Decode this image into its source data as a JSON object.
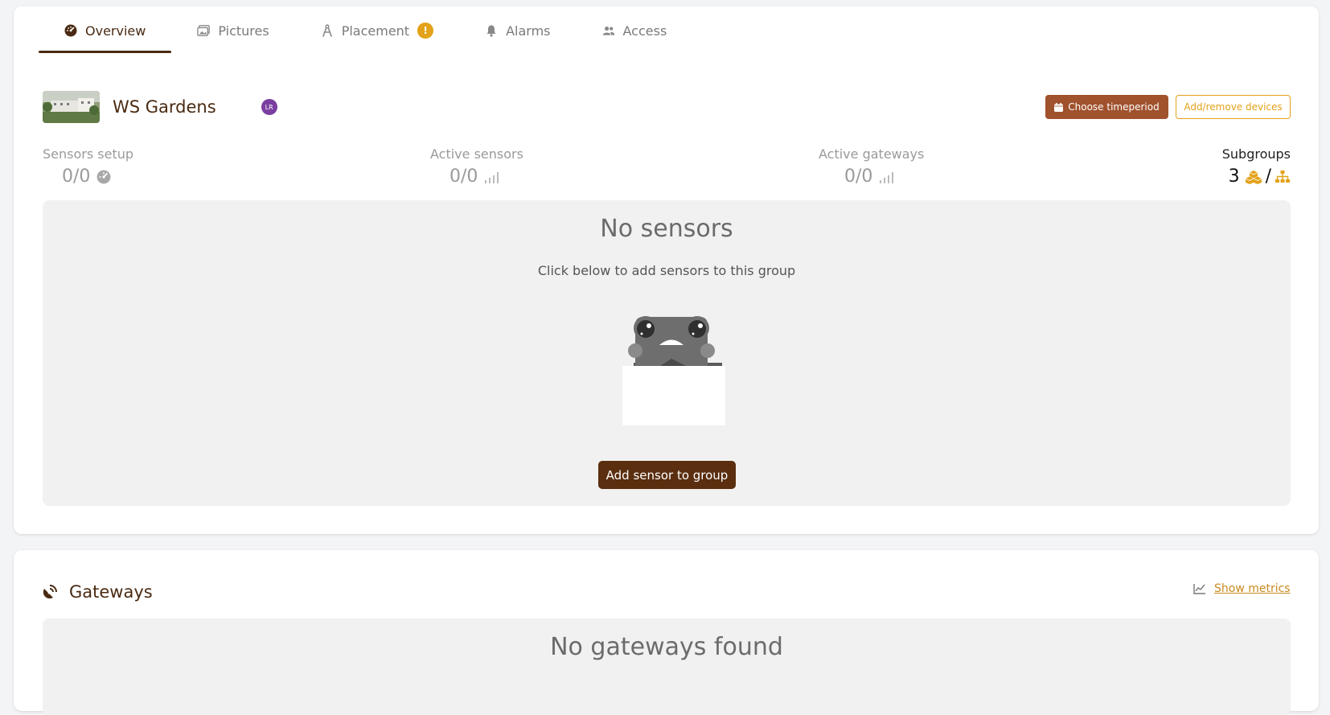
{
  "tabs": [
    {
      "label": "Overview",
      "icon": "dashboard-icon",
      "active": true
    },
    {
      "label": "Pictures",
      "icon": "images-icon"
    },
    {
      "label": "Placement",
      "icon": "compass-icon",
      "badge": "!"
    },
    {
      "label": "Alarms",
      "icon": "bell-icon"
    },
    {
      "label": "Access",
      "icon": "users-icon"
    }
  ],
  "group": {
    "name": "WS Gardens",
    "owner_initials": "LR"
  },
  "actions": {
    "choose_timeperiod": "Choose timeperiod",
    "add_remove_devices": "Add/remove devices"
  },
  "stats": {
    "sensors_setup": {
      "label": "Sensors setup",
      "value": "0/0"
    },
    "active_sensors": {
      "label": "Active sensors",
      "value": "0/0"
    },
    "active_gateways": {
      "label": "Active gateways",
      "value": "0/0"
    },
    "subgroups": {
      "label": "Subgroups",
      "value": "3",
      "separator": "/"
    }
  },
  "empty_sensors": {
    "title": "No sensors",
    "subtitle": "Click below to add sensors to this group",
    "button": "Add sensor to group"
  },
  "gateways": {
    "title": "Gateways",
    "metrics_link": "Show metrics",
    "empty_title": "No gateways found"
  },
  "colors": {
    "brand_dark": "#4a2a12",
    "accent_orange": "#e3a21a",
    "button_brown": "#a0522d",
    "owner_badge": "#7b3fa0"
  }
}
